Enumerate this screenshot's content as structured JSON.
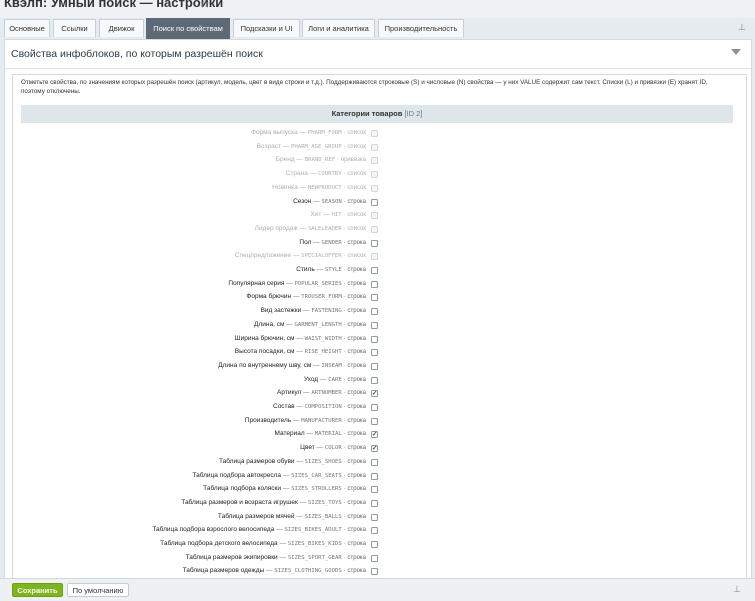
{
  "window": {
    "title": "Квэлп: Умный поиск — настройки",
    "star_icon": "☆"
  },
  "tabs": [
    {
      "label": "Основные",
      "active": false
    },
    {
      "label": "Ссылки",
      "active": false
    },
    {
      "label": "Движок",
      "active": false
    },
    {
      "label": "Поиск по свойствам",
      "active": true
    },
    {
      "label": "Подсказки и UI",
      "active": false
    },
    {
      "label": "Логи и аналитика",
      "active": false
    },
    {
      "label": "Производительность",
      "active": false
    }
  ],
  "section": {
    "title": "Свойства инфоблоков, по которым разрешён поиск",
    "description": "Отметьте свойства, по значениям которых разрешён поиск (артикул, модель, цвет в виде строки и т.д.). Поддерживаются строковые (S) и числовые (N) свойства — у них VALUE содержит сам текст. Списки (L) и привязки (E) хранят ID, поэтому отключены.",
    "category_title": "Категории товаров",
    "category_id": "[ID 2]"
  },
  "properties": [
    {
      "name": "Форма выпуска",
      "code": "PHARM_FORM",
      "type": "список",
      "enabled": false,
      "checked": false
    },
    {
      "name": "Возраст",
      "code": "PHARM_AGE_GROUP",
      "type": "список",
      "enabled": false,
      "checked": false
    },
    {
      "name": "Бренд",
      "code": "BRAND_REF",
      "type": "привязка",
      "enabled": false,
      "checked": false
    },
    {
      "name": "Страна",
      "code": "COUNTRY",
      "type": "список",
      "enabled": false,
      "checked": false
    },
    {
      "name": "Новинка",
      "code": "NEWPRODUCT",
      "type": "список",
      "enabled": false,
      "checked": false
    },
    {
      "name": "Сезон",
      "code": "SEASON",
      "type": "строка",
      "enabled": true,
      "checked": false
    },
    {
      "name": "Хит",
      "code": "HIT",
      "type": "список",
      "enabled": false,
      "checked": false
    },
    {
      "name": "Лидер продаж",
      "code": "SALELEADER",
      "type": "список",
      "enabled": false,
      "checked": false
    },
    {
      "name": "Пол",
      "code": "GENDER",
      "type": "строка",
      "enabled": true,
      "checked": false
    },
    {
      "name": "Спецпредложение",
      "code": "SPECIALOFFER",
      "type": "список",
      "enabled": false,
      "checked": false
    },
    {
      "name": "Стиль",
      "code": "STYLE",
      "type": "строка",
      "enabled": true,
      "checked": false
    },
    {
      "name": "Популярная серия",
      "code": "POPULAR_SERIES",
      "type": "строка",
      "enabled": true,
      "checked": false
    },
    {
      "name": "Форма брючин",
      "code": "TROUSER_FORM",
      "type": "строка",
      "enabled": true,
      "checked": false
    },
    {
      "name": "Вид застежки",
      "code": "FASTENING",
      "type": "строка",
      "enabled": true,
      "checked": false
    },
    {
      "name": "Длина, см",
      "code": "GARMENT_LENGTH",
      "type": "строка",
      "enabled": true,
      "checked": false
    },
    {
      "name": "Ширина брючин, см",
      "code": "WAIST_WIDTH",
      "type": "строка",
      "enabled": true,
      "checked": false
    },
    {
      "name": "Высота посадки, см",
      "code": "RISE_HEIGHT",
      "type": "строка",
      "enabled": true,
      "checked": false
    },
    {
      "name": "Длина по внутреннему шву, см",
      "code": "INSEAM",
      "type": "строка",
      "enabled": true,
      "checked": false
    },
    {
      "name": "Уход",
      "code": "CARE",
      "type": "строка",
      "enabled": true,
      "checked": false
    },
    {
      "name": "Артикул",
      "code": "ARTNUMBER",
      "type": "строка",
      "enabled": true,
      "checked": true
    },
    {
      "name": "Состав",
      "code": "COMPOSITION",
      "type": "строка",
      "enabled": true,
      "checked": false
    },
    {
      "name": "Производитель",
      "code": "MANUFACTURER",
      "type": "строка",
      "enabled": true,
      "checked": false
    },
    {
      "name": "Материал",
      "code": "MATERIAL",
      "type": "строка",
      "enabled": true,
      "checked": true
    },
    {
      "name": "Цвет",
      "code": "COLOR",
      "type": "строка",
      "enabled": true,
      "checked": true
    },
    {
      "name": "Таблица размеров обуви",
      "code": "SIZES_SHOES",
      "type": "строка",
      "enabled": true,
      "checked": false
    },
    {
      "name": "Таблица подбора автокресла",
      "code": "SIZES_CAR_SEATS",
      "type": "строка",
      "enabled": true,
      "checked": false
    },
    {
      "name": "Таблица подбора коляски",
      "code": "SIZES_STROLLERS",
      "type": "строка",
      "enabled": true,
      "checked": false
    },
    {
      "name": "Таблица размеров и возраста игрушек",
      "code": "SIZES_TOYS",
      "type": "строка",
      "enabled": true,
      "checked": false
    },
    {
      "name": "Таблица размеров мячей",
      "code": "SIZES_BALLS",
      "type": "строка",
      "enabled": true,
      "checked": false
    },
    {
      "name": "Таблица подбора взрослого велосипеда",
      "code": "SIZES_BIKES_ADULT",
      "type": "строка",
      "enabled": true,
      "checked": false
    },
    {
      "name": "Таблица подбора детского велосипеда",
      "code": "SIZES_BIKES_KIDS",
      "type": "строка",
      "enabled": true,
      "checked": false
    },
    {
      "name": "Таблица размеров экипировки",
      "code": "SIZES_SPORT_GEAR",
      "type": "строка",
      "enabled": true,
      "checked": false
    },
    {
      "name": "Таблица размеров одежды",
      "code": "SIZES_CLOTHING_GOODS",
      "type": "строка",
      "enabled": true,
      "checked": false
    }
  ],
  "footer": {
    "save_label": "Сохранить",
    "default_label": "По умолчанию",
    "pin_icon": "⊥"
  },
  "colors": {
    "save": "#7cb51c",
    "active_tab": "#5d6a75",
    "category_bar": "#dfe6e9"
  }
}
